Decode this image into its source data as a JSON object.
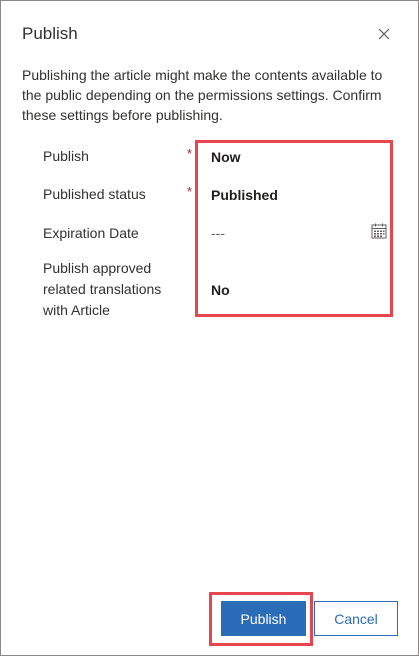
{
  "dialog": {
    "title": "Publish",
    "description": "Publishing the article might make the contents available to the public depending on the permissions settings. Confirm these settings before publishing."
  },
  "icons": {
    "close": "close-icon",
    "calendar": "calendar-icon"
  },
  "fields": [
    {
      "label": "Publish",
      "required": "*",
      "value": "Now"
    },
    {
      "label": "Published status",
      "required": "*",
      "value": "Published"
    },
    {
      "label": "Expiration Date",
      "required": "",
      "value": "---"
    },
    {
      "label": "Publish approved related translations with Article",
      "required": "",
      "value": "No"
    }
  ],
  "buttons": {
    "publish": "Publish",
    "cancel": "Cancel"
  },
  "colors": {
    "accent": "#2b6cb8",
    "required": "#a4262c",
    "highlight": "#e8464f"
  }
}
